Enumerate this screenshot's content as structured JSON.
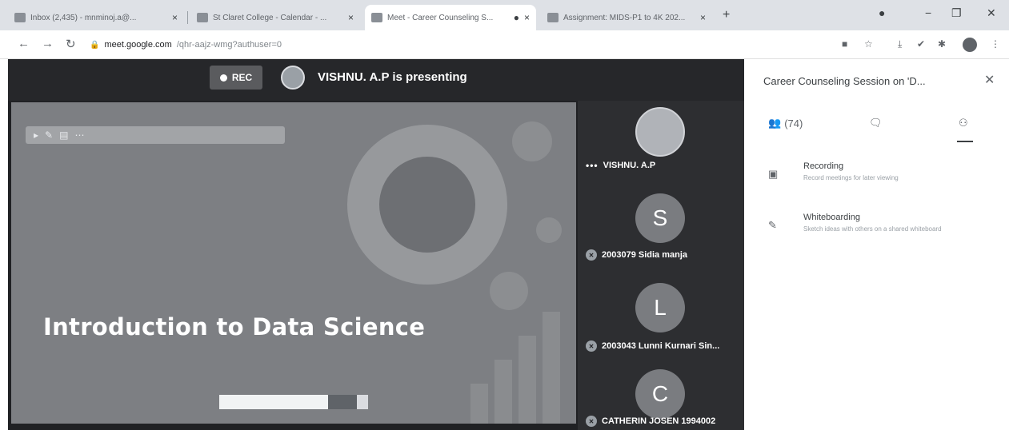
{
  "browser": {
    "tabs": [
      {
        "title": "Inbox (2,435) - mnminoj.a@...",
        "active": false
      },
      {
        "title": "St Claret College - Calendar - ...",
        "active": false
      },
      {
        "title": "Meet - Career Counseling S...",
        "active": true
      },
      {
        "title": "Assignment: MIDS-P1 to 4K 202...",
        "active": false
      }
    ],
    "url": {
      "host": "meet.google.com",
      "path": "/qhr-aajz-wmg?authuser=0"
    }
  },
  "meet": {
    "rec_label": "REC",
    "presenting_text": "VISHNU. A.P is presenting",
    "slide": {
      "title": "Introduction to Data Science"
    },
    "participants": [
      {
        "name": "VISHNU. A.P",
        "initial": "",
        "photo": true
      },
      {
        "name": "2003079 Sidia manja",
        "initial": "S",
        "photo": false
      },
      {
        "name": "2003043 Lunni Kurnari Sin...",
        "initial": "L",
        "photo": false
      },
      {
        "name": "CATHERIN JOSEN 1994002",
        "initial": "C",
        "photo": false
      }
    ]
  },
  "panel": {
    "title": "Career Counseling Session on 'D...",
    "close_icon": "✕",
    "tabs": [
      {
        "icon": "people-icon",
        "label": "(74)"
      },
      {
        "icon": "chat-icon",
        "label": ""
      },
      {
        "icon": "activities-icon",
        "label": ""
      }
    ],
    "activities": [
      {
        "icon": "record-icon",
        "name": "Recording",
        "description": "Record meetings for later viewing"
      },
      {
        "icon": "whiteboard-icon",
        "name": "Whiteboarding",
        "description": "Sketch ideas with others on a shared whiteboard"
      }
    ]
  }
}
